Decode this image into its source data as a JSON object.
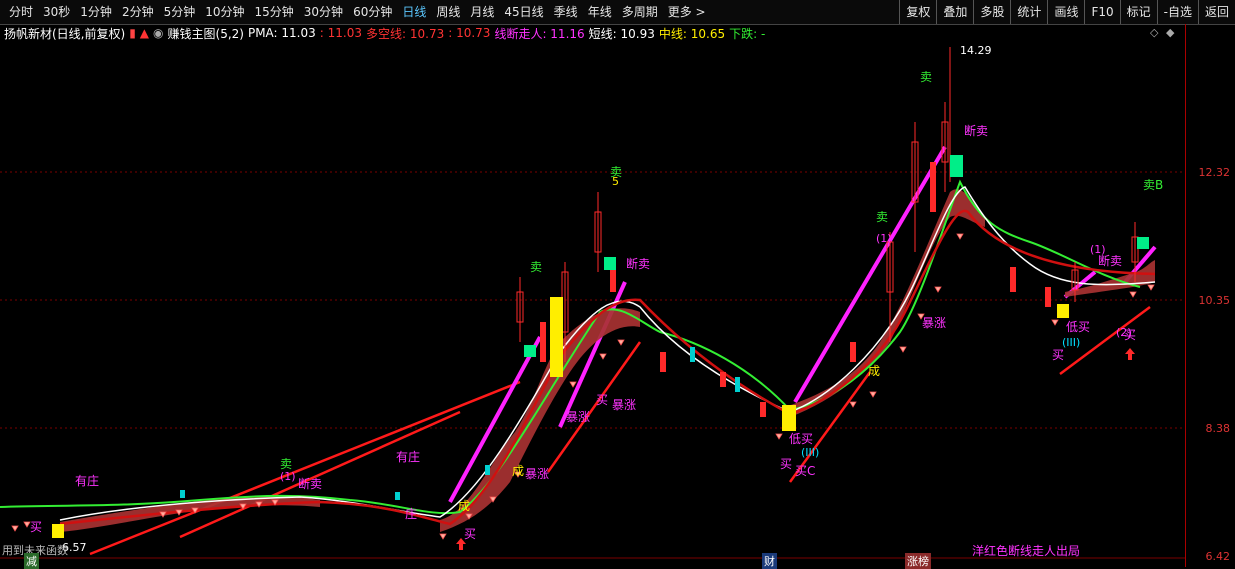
{
  "toolbar": {
    "periods": [
      "分时",
      "30秒",
      "1分钟",
      "2分钟",
      "5分钟",
      "10分钟",
      "15分钟",
      "30分钟",
      "60分钟",
      "日线",
      "周线",
      "月线",
      "45日线",
      "季线",
      "年线",
      "多周期",
      "更多 >"
    ],
    "active_period": "日线",
    "right_buttons": [
      "复权",
      "叠加",
      "多股",
      "统计",
      "画线",
      "F10",
      "标记",
      "-自选",
      "返回"
    ]
  },
  "info": {
    "stock": "扬帆新材(日线,前复权)",
    "indicator": "赚钱主图(5,2)",
    "pma": "PMA: 11.03",
    "pma2": ": 11.03",
    "duokong": "多空线: 10.73",
    "duokong2": ": 10.73",
    "xianduan": "线断走人: 11.16",
    "duanxian": "短线: 10.93",
    "zhongxian": "中线: 10.65",
    "xiadie": "下跌: -"
  },
  "y_axis": {
    "labels": [
      "12.32",
      "10.35",
      "8.38",
      "6.42"
    ]
  },
  "annotations": {
    "left_bottom": "用到未来函数",
    "price_low": "6.57",
    "price_high": "14.29",
    "bottom_note": "洋红色断线走人出局",
    "tags": [
      "减",
      "财",
      "涨榜"
    ],
    "youzhuang": "有庄",
    "mai": "卖",
    "duanmai": "断卖",
    "baozhang": "暴涨",
    "dimai": "低买",
    "buy": "买",
    "zhuang": "庄",
    "cheng": "成",
    "one": "(1)",
    "two": "(2)",
    "three": "(III)",
    "five": "5",
    "mai_b": "卖B",
    "mai_c": "买C"
  },
  "colors": {
    "up": "#ff2a2a",
    "down": "#00d0d0",
    "magenta": "#ff22ff",
    "green": "#33ee33",
    "yellow": "#ffee00",
    "band": "#a83232",
    "red_line": "#ff1a1a",
    "teal": "#00ee88"
  }
}
